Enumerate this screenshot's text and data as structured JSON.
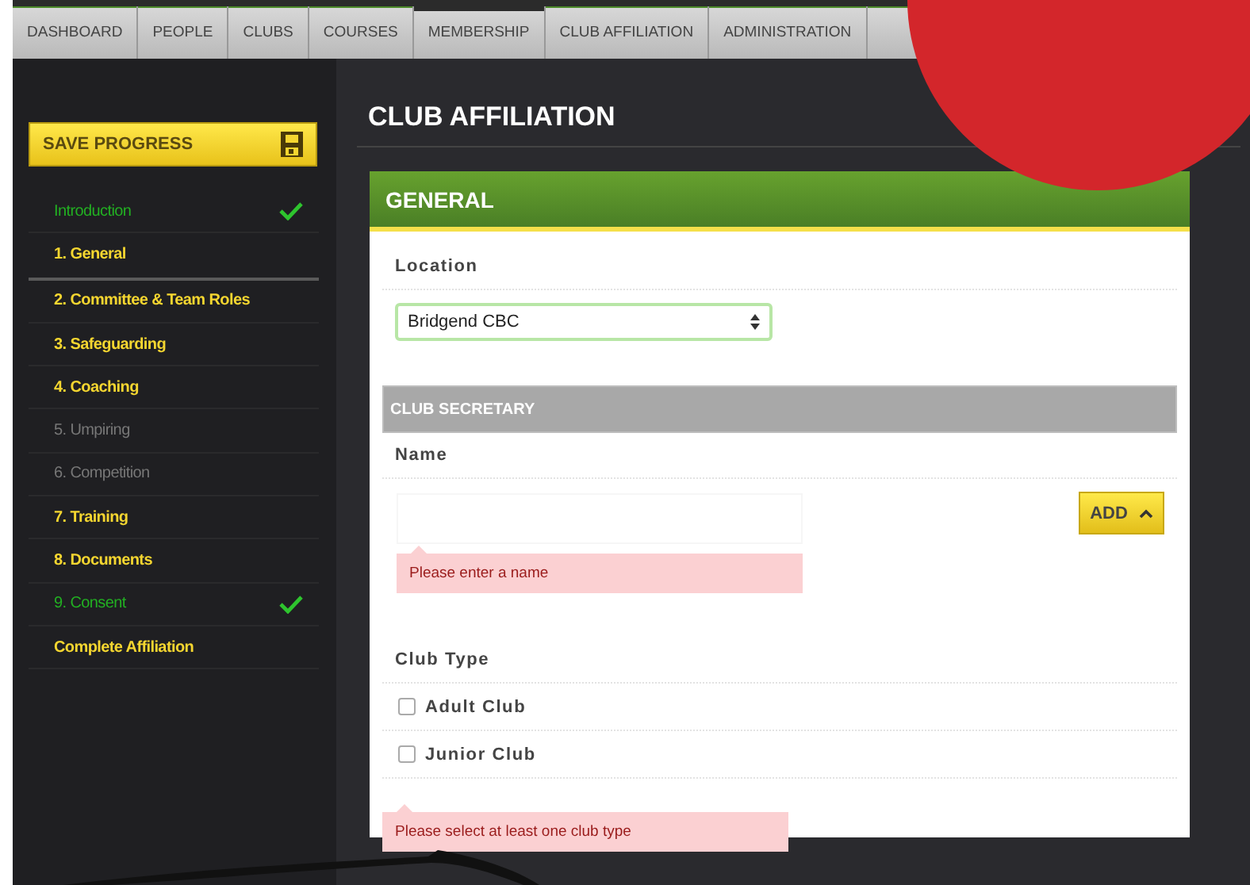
{
  "nav": [
    {
      "label": "DASHBOARD",
      "selected": false
    },
    {
      "label": "PEOPLE",
      "selected": false
    },
    {
      "label": "CLUBS",
      "selected": false
    },
    {
      "label": "COURSES",
      "selected": false
    },
    {
      "label": "MEMBERSHIP",
      "selected": true
    },
    {
      "label": "CLUB AFFILIATION",
      "selected": false
    },
    {
      "label": "ADMINISTRATION",
      "selected": false
    }
  ],
  "sidebar": {
    "save_button": "SAVE PROGRESS",
    "items": [
      {
        "label": "Introduction",
        "completed": true,
        "disabled": false,
        "selected": false
      },
      {
        "label": "1. General",
        "completed": false,
        "disabled": false,
        "selected": true
      },
      {
        "label": "2. Committee & Team Roles",
        "completed": false,
        "disabled": false,
        "selected": false
      },
      {
        "label": "3. Safeguarding",
        "completed": false,
        "disabled": false,
        "selected": false
      },
      {
        "label": "4. Coaching",
        "completed": false,
        "disabled": false,
        "selected": false
      },
      {
        "label": "5. Umpiring",
        "completed": false,
        "disabled": true,
        "selected": false
      },
      {
        "label": "6. Competition",
        "completed": false,
        "disabled": true,
        "selected": false
      },
      {
        "label": "7. Training",
        "completed": false,
        "disabled": false,
        "selected": false
      },
      {
        "label": "8. Documents",
        "completed": false,
        "disabled": false,
        "selected": false
      },
      {
        "label": "9. Consent",
        "completed": true,
        "disabled": false,
        "selected": false
      },
      {
        "label": "Complete Affiliation",
        "completed": false,
        "disabled": false,
        "selected": false
      }
    ]
  },
  "page_title": "CLUB AFFILIATION",
  "card": {
    "title": "GENERAL",
    "location": {
      "label": "Location",
      "value": "Bridgend CBC"
    },
    "section_title": "CLUB SECRETARY",
    "name": {
      "label": "Name",
      "error": "Please enter a name"
    },
    "add_button": "ADD",
    "club_type": {
      "label": "Club Type",
      "options": [
        {
          "label": "Adult Club",
          "checked": false
        },
        {
          "label": "Junior Club",
          "checked": false
        }
      ],
      "error": "Please select at least one club type"
    }
  }
}
